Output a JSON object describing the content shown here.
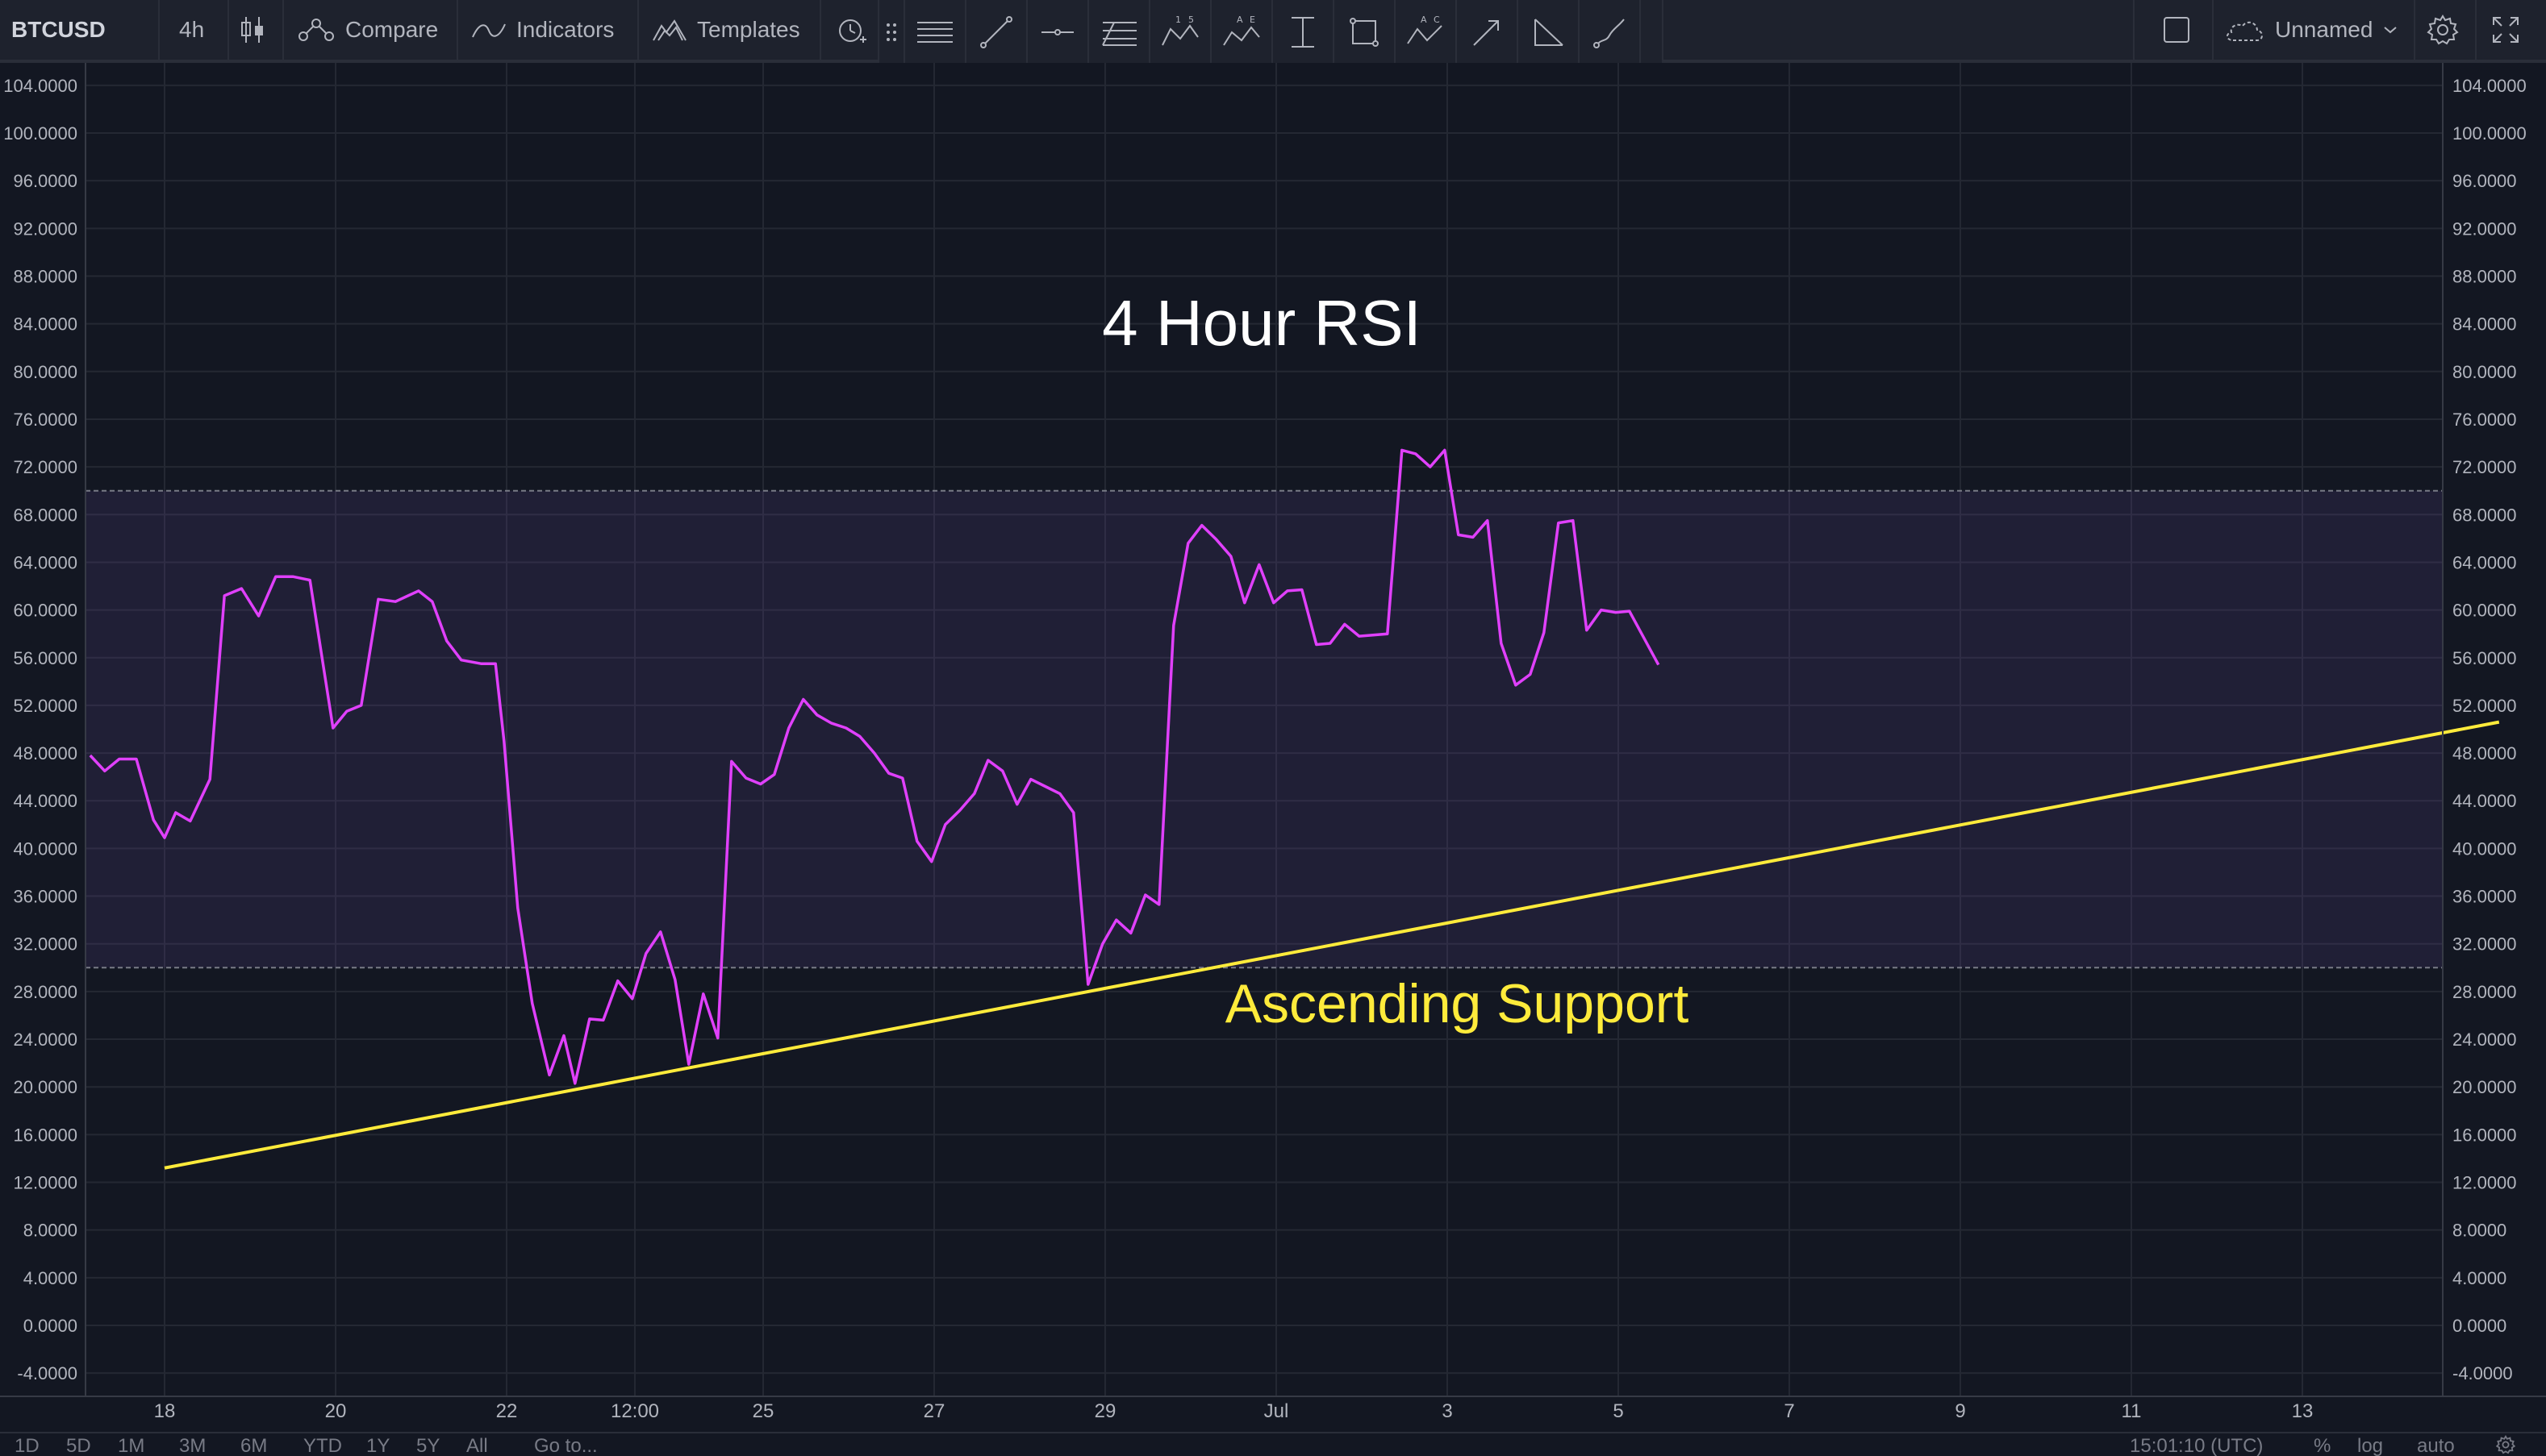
{
  "toolbar": {
    "symbol": "BTCUSD",
    "interval": "4h",
    "compare_label": "Compare",
    "indicators_label": "Indicators",
    "templates_label": "Templates",
    "layout_name": "Unnamed"
  },
  "drawing_tools": [
    "horizontal-lines-icon",
    "trend-line-icon",
    "horizontal-line-icon",
    "fib-retracement-icon",
    "xabcd-pattern-icon",
    "elliott-wave-icon",
    "date-range-icon",
    "rectangle-icon",
    "abcd-pattern-icon",
    "arrow-icon",
    "angle-icon",
    "brush-icon"
  ],
  "colors": {
    "background": "#131722",
    "rsi_line": "#e040fb",
    "band_fill": "#7e57c2",
    "support_line": "#ffeb3b",
    "title_text": "#ffffff",
    "support_text": "#ffeb3b"
  },
  "chart_data": {
    "type": "line",
    "title": "4 Hour RSI",
    "annotation": "Ascending Support",
    "ylim": [
      -6,
      106
    ],
    "y_ticks": [
      "104.0000",
      "100.0000",
      "96.0000",
      "92.0000",
      "88.0000",
      "84.0000",
      "80.0000",
      "76.0000",
      "72.0000",
      "68.0000",
      "64.0000",
      "60.0000",
      "56.0000",
      "52.0000",
      "48.0000",
      "44.0000",
      "40.0000",
      "36.0000",
      "32.0000",
      "28.0000",
      "24.0000",
      "20.0000",
      "16.0000",
      "12.0000",
      "8.0000",
      "4.0000",
      "0.0000",
      "-4.0000"
    ],
    "x_ticks": [
      {
        "label": "18",
        "d": 18
      },
      {
        "label": "20",
        "d": 20
      },
      {
        "label": "22",
        "d": 22
      },
      {
        "label": "12:00",
        "d": 23.5
      },
      {
        "label": "25",
        "d": 25
      },
      {
        "label": "27",
        "d": 27
      },
      {
        "label": "29",
        "d": 29
      },
      {
        "label": "Jul",
        "d": 31
      },
      {
        "label": "3",
        "d": 33
      },
      {
        "label": "5",
        "d": 35
      },
      {
        "label": "7",
        "d": 37
      },
      {
        "label": "9",
        "d": 39
      },
      {
        "label": "11",
        "d": 41
      },
      {
        "label": "13",
        "d": 43
      }
    ],
    "band": {
      "upper": 70,
      "lower": 30
    },
    "support_line": {
      "start": [
        18,
        13.2
      ],
      "end": [
        45.3,
        50.6
      ]
    },
    "series": [
      {
        "x": [
          17.13,
          17.3,
          17.47,
          17.67,
          17.87,
          18,
          18.13,
          18.3,
          18.53,
          18.7,
          18.9,
          19.1,
          19.3,
          19.5,
          19.7,
          19.97,
          20.13,
          20.3,
          20.5,
          20.7,
          20.97,
          21.13,
          21.3,
          21.47,
          21.7,
          21.87,
          21.97,
          22.13,
          22.3,
          22.5,
          22.67,
          22.8,
          22.97,
          23.13,
          23.3,
          23.47,
          23.63,
          23.8,
          23.97,
          24.13,
          24.3,
          24.47,
          24.63,
          24.8,
          24.97,
          25.13,
          25.3,
          25.47,
          25.63,
          25.8,
          25.97,
          26.13,
          26.3,
          26.47,
          26.63,
          26.8,
          26.97,
          27.13,
          27.3,
          27.47,
          27.63,
          27.8,
          27.97,
          28.13,
          28.3,
          28.47,
          28.63,
          28.8,
          28.97,
          29.13,
          29.3,
          29.47,
          29.63,
          29.8,
          29.97,
          30.13,
          30.3,
          30.47,
          30.63,
          30.8,
          30.97,
          31.13,
          31.3,
          31.47,
          31.63,
          31.8,
          31.97,
          32.13,
          32.3,
          32.47,
          32.63,
          32.8,
          32.97,
          33.13,
          33.3,
          33.47,
          33.63,
          33.8,
          33.97,
          34.13,
          34.3,
          34.47,
          34.63,
          34.8,
          34.97,
          35.13,
          35.47
        ],
        "y": [
          47.8,
          46.5,
          47.5,
          47.5,
          42.4,
          40.9,
          43,
          42.3,
          45.8,
          61.2,
          61.8,
          59.5,
          62.8,
          62.8,
          62.5,
          50.1,
          51.5,
          52,
          60.9,
          60.7,
          61.6,
          60.7,
          57.4,
          55.8,
          55.5,
          55.5,
          49,
          35,
          27,
          21,
          24.3,
          20.3,
          25.7,
          25.6,
          28.9,
          27.4,
          31.2,
          33,
          29,
          21.9,
          27.8,
          24.1,
          47.3,
          45.9,
          45.4,
          46.2,
          50.1,
          52.5,
          51.2,
          50.5,
          50.1,
          49.4,
          48,
          46.3,
          45.9,
          40.6,
          38.9,
          42,
          43.2,
          44.6,
          47.4,
          46.5,
          43.7,
          45.8,
          45.2,
          44.6,
          43,
          28.6,
          32,
          34,
          32.9,
          36.1,
          35.3,
          58.7,
          65.6,
          67.1,
          65.9,
          64.5,
          60.6,
          63.8,
          60.6,
          61.6,
          61.7,
          57.1,
          57.2,
          58.8,
          57.8,
          57.9,
          58,
          73.4,
          73.1,
          72,
          73.4,
          66.3,
          66.1,
          67.5,
          57.2,
          53.7,
          54.6,
          58.1,
          67.3,
          67.5,
          58.3,
          60,
          59.8,
          59.9,
          55.4
        ]
      }
    ]
  },
  "bottom": {
    "ranges": [
      "1D",
      "5D",
      "1M",
      "3M",
      "6M",
      "YTD",
      "1Y",
      "5Y",
      "All"
    ],
    "goto_label": "Go to...",
    "time_label": "15:01:10 (UTC)",
    "pct_label": "%",
    "log_label": "log",
    "auto_label": "auto"
  }
}
